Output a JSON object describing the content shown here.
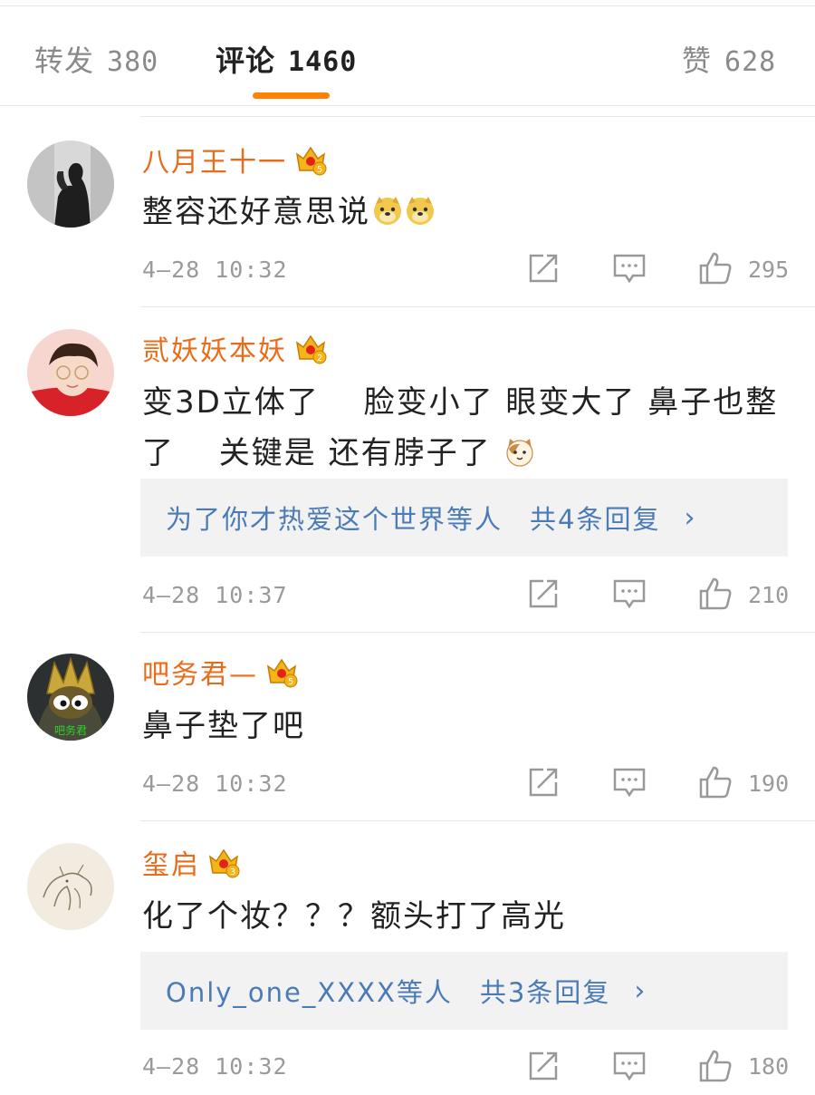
{
  "tabs": {
    "reposts": {
      "label": "转发",
      "count": "380"
    },
    "comments": {
      "label": "评论",
      "count": "1460"
    },
    "likes": {
      "label": "赞",
      "count": "628"
    }
  },
  "colors": {
    "accent": "#ff8200",
    "username": "#e86c1a",
    "link": "#4a7bb7",
    "meta": "#9a9a9a"
  },
  "comments": [
    {
      "user": "八月王十一",
      "badge_level": "5",
      "text": "整容还好意思说",
      "emojis": [
        "doge-emoji",
        "doge-emoji"
      ],
      "time": "4—28 10:32",
      "likes": "295"
    },
    {
      "user": "贰妖妖本妖",
      "badge_level": "2",
      "text": "变3D立体了　 脸变小了  眼变大了  鼻子也整了　 关键是 还有脖子了 ",
      "emojis": [
        "cat-emoji"
      ],
      "reply": {
        "users": "为了你才热爱这个世界等人",
        "count": "共4条回复",
        "chevron": "›"
      },
      "time": "4—28 10:37",
      "likes": "210"
    },
    {
      "user": "吧务君—",
      "badge_level": "5",
      "text": "鼻子垫了吧",
      "avatar_text": "吧务君",
      "time": "4—28 10:32",
      "likes": "190"
    },
    {
      "user": "玺启",
      "badge_level": "3",
      "text": "化了个妆？？？额头打了高光",
      "reply": {
        "users": "Only_one_XXXX等人",
        "count": "共3条回复",
        "chevron": "›"
      },
      "time": "4—28 10:32",
      "likes": "180"
    }
  ]
}
